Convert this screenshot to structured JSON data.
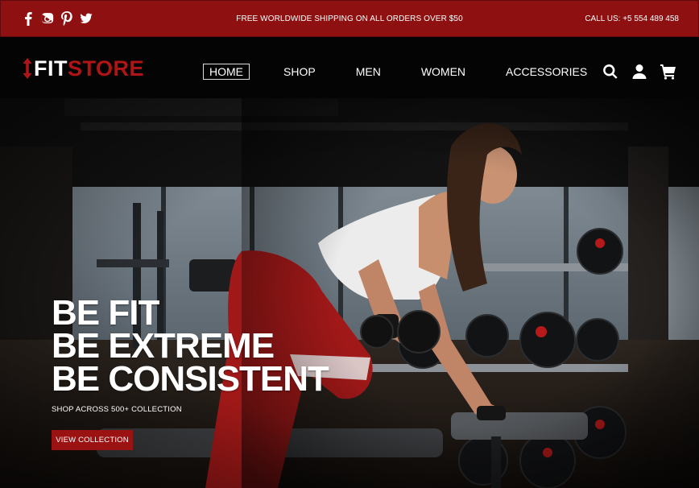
{
  "topbar": {
    "shipping_text": "FREE WORLDWIDE SHIPPING ON ALL ORDERS OVER $50",
    "call_text": "CALL US: +5 554 489 458",
    "social": [
      "facebook-icon",
      "instagram-icon",
      "pinterest-icon",
      "twitter-icon"
    ]
  },
  "nav": {
    "logo_part1": "FIT",
    "logo_part2": "STORE",
    "items": [
      {
        "label": "HOME",
        "active": true
      },
      {
        "label": "SHOP",
        "active": false
      },
      {
        "label": "MEN",
        "active": false
      },
      {
        "label": "WOMEN",
        "active": false
      },
      {
        "label": "ACCESSORIES",
        "active": false
      }
    ],
    "icons": [
      "search-icon",
      "user-icon",
      "cart-icon"
    ]
  },
  "hero": {
    "lines": [
      "BE FIT",
      "BE EXTREME",
      "BE CONSISTENT"
    ],
    "subtitle": "SHOP ACROSS 500+ COLLECTION",
    "cta_label": "VIEW COLLECTION"
  },
  "colors": {
    "brand_red": "#8e1010",
    "logo_red": "#b01515",
    "nav_bg": "#040404",
    "text_white": "#ffffff"
  }
}
